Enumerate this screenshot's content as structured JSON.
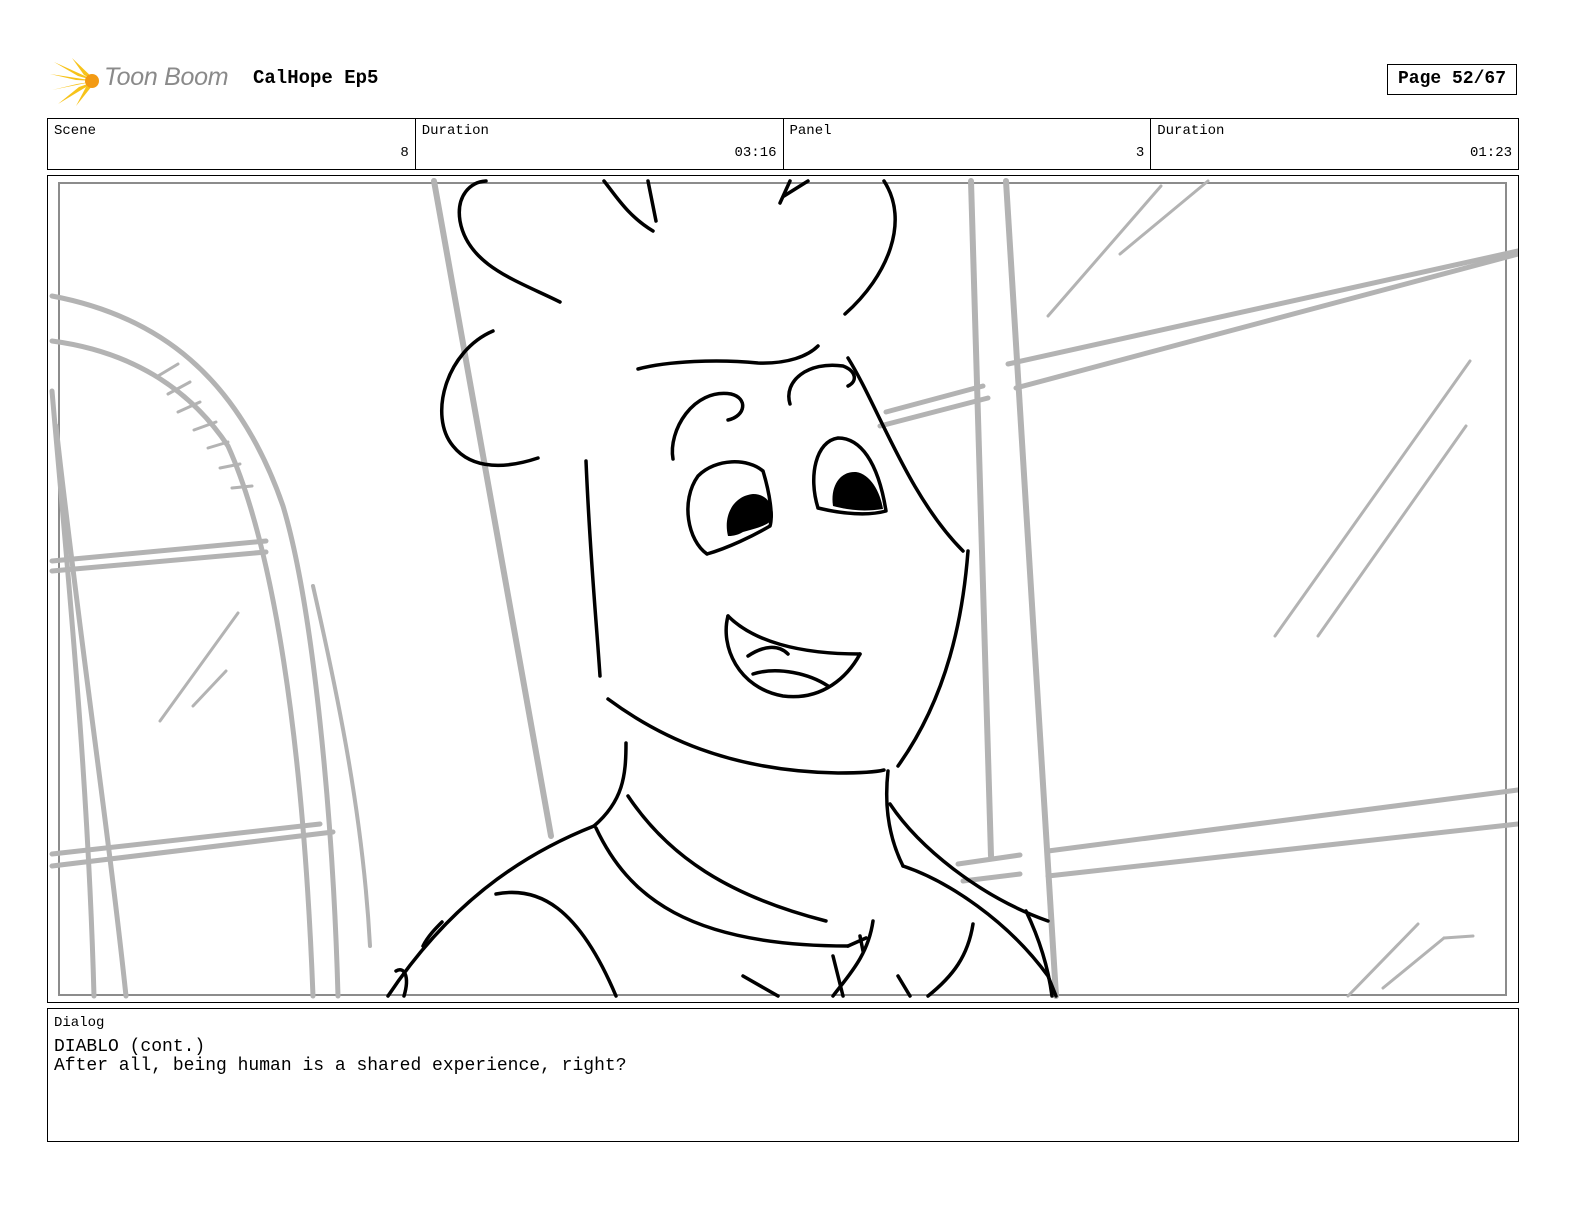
{
  "header": {
    "logo_text": "Toon Boom",
    "project_title": "CalHope Ep5",
    "page_label": "Page 52/67"
  },
  "info": {
    "scene_label": "Scene",
    "scene_value": "8",
    "scene_duration_label": "Duration",
    "scene_duration_value": "03:16",
    "panel_label": "Panel",
    "panel_value": "3",
    "panel_duration_label": "Duration",
    "panel_duration_value": "01:23"
  },
  "dialog": {
    "label": "Dialog",
    "speaker": "DIABLO (cont.)",
    "line": "After all, being human is a shared experience, right?"
  }
}
